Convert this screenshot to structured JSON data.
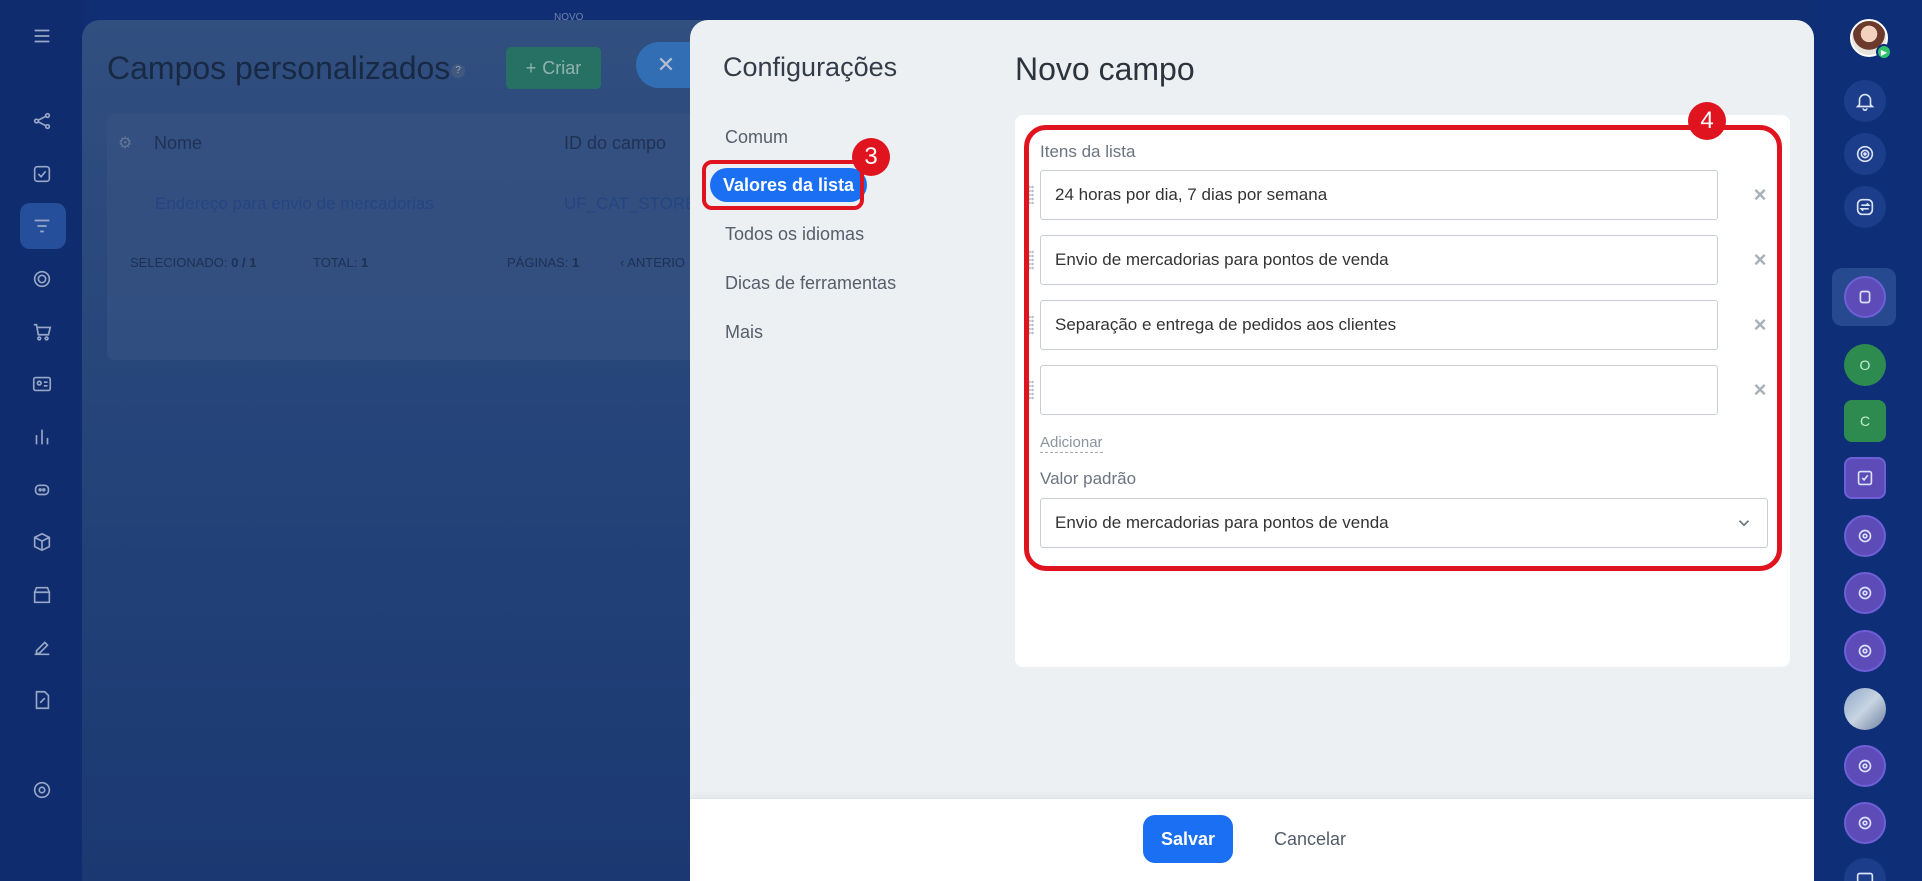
{
  "background": {
    "novo_label": "NOVO",
    "page_title": "Campos personalizados",
    "help_icon": "?",
    "create_button": "Criar",
    "table": {
      "columns": [
        "Nome",
        "ID do campo"
      ],
      "row": {
        "name": "Endereço para envio de mercadorias",
        "id": "UF_CAT_STORE_"
      },
      "footer": {
        "selected_label": "SELECIONADO:",
        "selected_value": "0 / 1",
        "total_label": "TOTAL:",
        "total_value": "1",
        "pages_label": "PÁGINAS:",
        "pages_value": "1",
        "prev_label": "ANTERIO"
      }
    }
  },
  "slider": {
    "nav_title": "Configurações",
    "nav_items": [
      "Comum",
      "Valores da lista",
      "Todos os idiomas",
      "Dicas de ferramentas",
      "Mais"
    ],
    "active_nav": "Valores da lista",
    "content_title": "Novo campo",
    "list_items_label": "Itens da lista",
    "list_items": [
      "24 horas por dia, 7 dias por semana",
      "Envio de mercadorias para pontos de venda",
      "Separação e entrega de pedidos aos clientes",
      ""
    ],
    "add_link": "Adicionar",
    "default_value_label": "Valor padrão",
    "default_value": "Envio de mercadorias para pontos de venda",
    "save_button": "Salvar",
    "cancel_button": "Cancelar"
  },
  "annotations": {
    "badge_3": "3",
    "badge_4": "4"
  },
  "right_rail": {
    "contact_o": "O",
    "contact_c": "C"
  },
  "colors": {
    "accent": "#1a6ff2",
    "highlight_red": "#e0141e",
    "rail_dark": "#0e2e78"
  }
}
